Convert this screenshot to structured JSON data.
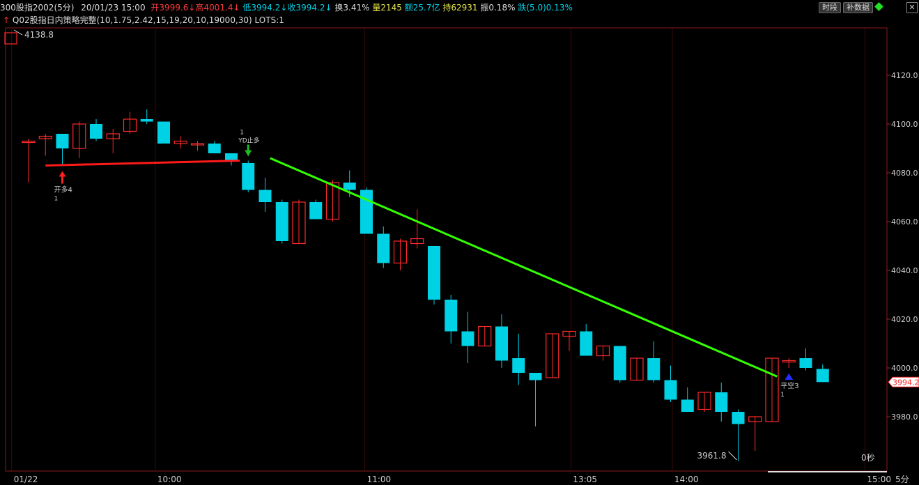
{
  "header": {
    "symbol": "300股指2002(5分)",
    "datetime": "20/01/23 15:00",
    "open_label": "开",
    "open": "3999.6",
    "high_label": "高",
    "high": "4001.4",
    "low_label": "低",
    "low": "3994.2",
    "close_label": "收",
    "close": "3994.2",
    "turnover_label": "换",
    "turnover": "3.41%",
    "volume_label": "量",
    "volume": "2145",
    "amount_label": "额",
    "amount": "25.7亿",
    "oi_label": "持",
    "oi": "62931",
    "amplitude_label": "振",
    "amplitude": "0.18%",
    "change_label": "跌(5.0)",
    "change": "0.13%",
    "strategy": "Q02股指日内策略完整(10,1.75,2.42,15,19,20,10,19000,30)",
    "lots": "LOTS:1"
  },
  "toolbar": {
    "timeshare_label": "时段",
    "fill_data_label": "补数据"
  },
  "colors": {
    "up": "#ff2a2a",
    "down": "#00d2e6",
    "axis": "#8a1a1a",
    "text": "#d0d0d0",
    "trend_red": "#ff1a1a",
    "trend_green": "#33ff00"
  },
  "chart_data": {
    "type": "candlestick",
    "timeframe": "5分",
    "ylim": [
      3960,
      4140
    ],
    "yticks": [
      "4120.0",
      "4100.0",
      "4080.0",
      "4060.0",
      "4040.0",
      "4020.0",
      "4000.0",
      "3980.0"
    ],
    "xticks": [
      "01/22",
      "10:00",
      "11:00",
      "13:05",
      "14:00",
      "15:00"
    ],
    "max_label": "4138.8",
    "min_label": "3961.8",
    "last_price": "3994.2",
    "countdown": "0秒",
    "candles": [
      [
        4093,
        4094,
        4076,
        4093
      ],
      [
        4094,
        4096,
        4087,
        4095
      ],
      [
        4096,
        4096,
        4083,
        4090
      ],
      [
        4090,
        4101,
        4086,
        4100
      ],
      [
        4100,
        4102,
        4093,
        4094
      ],
      [
        4094,
        4098,
        4088,
        4096
      ],
      [
        4097,
        4105,
        4096,
        4102
      ],
      [
        4102,
        4106,
        4100,
        4101
      ],
      [
        4101,
        4101,
        4092,
        4092
      ],
      [
        4092,
        4095,
        4090,
        4093
      ],
      [
        4092,
        4093,
        4089,
        4092
      ],
      [
        4092,
        4093,
        4088,
        4088
      ],
      [
        4088,
        4088,
        4083,
        4085
      ],
      [
        4084,
        4085,
        4072,
        4073
      ],
      [
        4073,
        4078,
        4064,
        4068
      ],
      [
        4068,
        4069,
        4051,
        4052
      ],
      [
        4051,
        4069,
        4051,
        4068
      ],
      [
        4068,
        4069,
        4061,
        4061
      ],
      [
        4061,
        4077,
        4060,
        4076
      ],
      [
        4076,
        4081,
        4070,
        4073
      ],
      [
        4073,
        4074,
        4055,
        4055
      ],
      [
        4055,
        4058,
        4041,
        4043
      ],
      [
        4043,
        4053,
        4040,
        4052
      ],
      [
        4051,
        4065,
        4049,
        4053
      ],
      [
        4050,
        4050,
        4026,
        4028
      ],
      [
        4028,
        4030,
        4010,
        4015
      ],
      [
        4015,
        4023,
        4002,
        4009
      ],
      [
        4009,
        4017,
        4009,
        4017
      ],
      [
        4017,
        4022,
        4000,
        4003
      ],
      [
        4004,
        4014,
        3993,
        3998
      ],
      [
        3998,
        3998,
        3976,
        3995
      ],
      [
        3996,
        4014,
        3996,
        4014
      ],
      [
        4013,
        4015,
        4007,
        4015
      ],
      [
        4015,
        4018,
        4005,
        4005
      ],
      [
        4005,
        4009,
        4003,
        4009
      ],
      [
        4009,
        4009,
        3994,
        3995
      ],
      [
        3995,
        4004,
        3995,
        4004
      ],
      [
        4004,
        4011,
        3994,
        3995
      ],
      [
        3995,
        4001,
        3986,
        3987
      ],
      [
        3987,
        3992,
        3982,
        3982
      ],
      [
        3983,
        3990,
        3982,
        3990
      ],
      [
        3990,
        3994,
        3978,
        3982
      ],
      [
        3982,
        3983,
        3961.8,
        3977
      ],
      [
        3978,
        3980,
        3966,
        3980
      ],
      [
        3978,
        4004,
        3978,
        4004
      ],
      [
        4003,
        4004,
        4000,
        4003
      ],
      [
        4004,
        4008,
        3999,
        4000
      ],
      [
        3999.6,
        4001.4,
        3994.2,
        3994.2
      ]
    ],
    "signals": [
      {
        "bar": 2,
        "type": "buy",
        "label": "开多4",
        "qty": "1"
      },
      {
        "bar": 13,
        "type": "stop",
        "label": "YD止多",
        "qty": "1"
      },
      {
        "bar": 45,
        "type": "cover",
        "label": "平空3",
        "qty": "1"
      }
    ],
    "trendlines": [
      {
        "color": "red",
        "from": {
          "bar": 1,
          "price": 4083
        },
        "to": {
          "bar": 12.5,
          "price": 4085
        }
      },
      {
        "color": "green",
        "from": {
          "bar": 14.3,
          "price": 4086
        },
        "to": {
          "bar": 44.3,
          "price": 3996.5
        }
      }
    ]
  }
}
